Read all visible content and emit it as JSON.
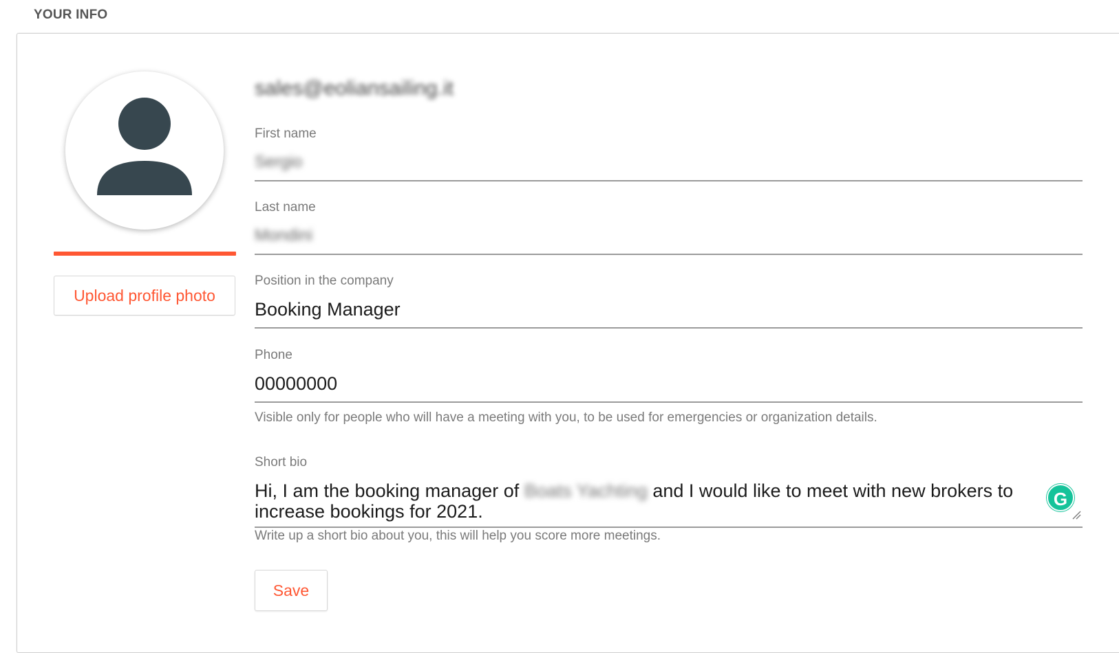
{
  "section": {
    "title": "YOUR INFO"
  },
  "profile": {
    "upload_label": "Upload profile photo",
    "avatar_icon": "user-silhouette-icon",
    "completion_color": "#ff5733"
  },
  "account": {
    "email": "sales@eoliansailing.it"
  },
  "form": {
    "first_name": {
      "label": "First name",
      "value": "Sergio"
    },
    "last_name": {
      "label": "Last name",
      "value": "Mondini"
    },
    "position": {
      "label": "Position in the company",
      "value": "Booking Manager"
    },
    "phone": {
      "label": "Phone",
      "value": "00000000",
      "helper": "Visible only for people who will have a meeting with you, to be used for emergencies or organization details."
    },
    "bio": {
      "label": "Short bio",
      "value_prefix": "Hi, I am the booking manager of ",
      "value_redacted": "Boats Yachting",
      "value_suffix": " and I would like to meet with new brokers to increase bookings for 2021.",
      "helper": "Write up a short bio about you, this will help you score more meetings."
    }
  },
  "actions": {
    "save_label": "Save"
  },
  "grammarly": {
    "icon": "grammarly-icon",
    "glyph": "G",
    "color": "#15c39a"
  },
  "colors": {
    "accent": "#ff5733",
    "avatar_fill": "#37474f"
  }
}
